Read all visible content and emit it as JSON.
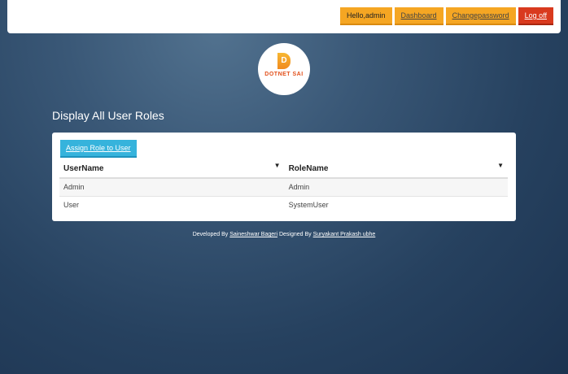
{
  "nav": {
    "greeting": "Hello,admin",
    "dashboard": "Dashboard",
    "change_password": "Changepassword",
    "logoff": "Log off"
  },
  "logo": {
    "text": "DOTNET SAI",
    "letter": "D"
  },
  "page_title": "Display All User Roles",
  "assign_button": "Assign Role to User",
  "table": {
    "headers": [
      "UserName",
      "RoleName"
    ],
    "rows": [
      [
        "Admin",
        "Admin"
      ],
      [
        "User",
        "SystemUser"
      ]
    ]
  },
  "footer": {
    "developed_by": "Developed By",
    "developer": "Saineshwar Bageri",
    "designed_by": "Designed By",
    "designer": "Suryakant Prakash ubhe"
  }
}
